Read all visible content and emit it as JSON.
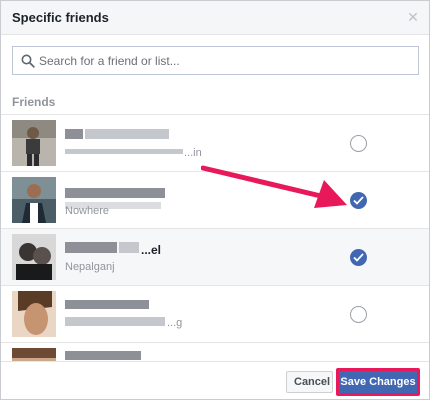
{
  "dialog": {
    "title": "Specific friends",
    "close_icon": "close-icon"
  },
  "search": {
    "placeholder": "Search for a friend or list...",
    "value": ""
  },
  "section_label": "Friends",
  "friends": [
    {
      "name": "",
      "subtitle": "...in",
      "selected": false
    },
    {
      "name": "",
      "subtitle": "Nowhere",
      "selected": true
    },
    {
      "name": "...el",
      "subtitle": "Nepalganj",
      "selected": true
    },
    {
      "name": "",
      "subtitle": "...g",
      "selected": false
    },
    {
      "name": "",
      "subtitle": "",
      "selected": false
    }
  ],
  "footer": {
    "cancel_label": "Cancel",
    "save_label": "Save Changes"
  },
  "colors": {
    "accent": "#4267b2",
    "highlight": "#e8195a"
  }
}
